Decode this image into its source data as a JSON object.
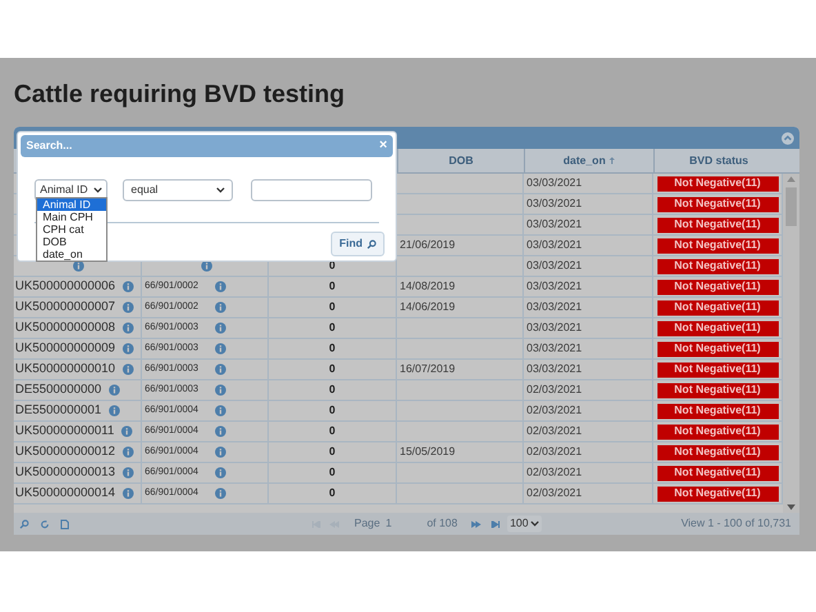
{
  "page_title": "Cattle requiring BVD testing",
  "grid": {
    "columns": [
      {
        "label": "DOB",
        "sorted": false
      },
      {
        "label": "date_on",
        "sorted": true
      },
      {
        "label": "BVD status",
        "sorted": false
      }
    ],
    "rows": [
      {
        "date_on": "03/03/2021",
        "status": "Not Negative(11)"
      },
      {
        "date_on": "03/03/2021",
        "status": "Not Negative(11)"
      },
      {
        "date_on": "03/03/2021",
        "status": "Not Negative(11)"
      },
      {
        "dob": "21/06/2019",
        "date_on": "03/03/2021",
        "status": "Not Negative(11)"
      },
      {
        "icons": true,
        "cph_cat": "0",
        "date_on": "03/03/2021",
        "status": "Not Negative(11)"
      },
      {
        "icons": true,
        "animal_id": "UK500000000006",
        "main_cph": "66/901/0002",
        "cph_cat": "0",
        "dob": "14/08/2019",
        "date_on": "03/03/2021",
        "status": "Not Negative(11)"
      },
      {
        "icons": true,
        "animal_id": "UK500000000007",
        "main_cph": "66/901/0002",
        "cph_cat": "0",
        "dob": "14/06/2019",
        "date_on": "03/03/2021",
        "status": "Not Negative(11)"
      },
      {
        "icons": true,
        "animal_id": "UK500000000008",
        "main_cph": "66/901/0003",
        "cph_cat": "0",
        "date_on": "03/03/2021",
        "status": "Not Negative(11)"
      },
      {
        "icons": true,
        "animal_id": "UK500000000009",
        "main_cph": "66/901/0003",
        "cph_cat": "0",
        "date_on": "03/03/2021",
        "status": "Not Negative(11)"
      },
      {
        "icons": true,
        "animal_id": "UK500000000010",
        "main_cph": "66/901/0003",
        "cph_cat": "0",
        "dob": "16/07/2019",
        "date_on": "03/03/2021",
        "status": "Not Negative(11)"
      },
      {
        "icons": true,
        "animal_id": "DE5500000000",
        "main_cph": "66/901/0003",
        "cph_cat": "0",
        "date_on": "02/03/2021",
        "status": "Not Negative(11)"
      },
      {
        "icons": true,
        "animal_id": "DE5500000001",
        "main_cph": "66/901/0004",
        "cph_cat": "0",
        "date_on": "02/03/2021",
        "status": "Not Negative(11)"
      },
      {
        "icons": true,
        "animal_id": "UK500000000011",
        "main_cph": "66/901/0004",
        "cph_cat": "0",
        "date_on": "02/03/2021",
        "status": "Not Negative(11)"
      },
      {
        "icons": true,
        "animal_id": "UK500000000012",
        "main_cph": "66/901/0004",
        "cph_cat": "0",
        "dob": "15/05/2019",
        "date_on": "02/03/2021",
        "status": "Not Negative(11)"
      },
      {
        "icons": true,
        "animal_id": "UK500000000013",
        "main_cph": "66/901/0004",
        "cph_cat": "0",
        "date_on": "02/03/2021",
        "status": "Not Negative(11)"
      },
      {
        "icons": true,
        "animal_id": "UK500000000014",
        "main_cph": "66/901/0004",
        "cph_cat": "0",
        "date_on": "02/03/2021",
        "status": "Not Negative(11)"
      }
    ],
    "pager": {
      "page_label": "Page",
      "page": "1",
      "of_pages": "of 108",
      "page_size": "100",
      "summary": "View 1 - 100 of 10,731"
    }
  },
  "search_dialog": {
    "title": "Search...",
    "close": "×",
    "field": "Animal ID",
    "field_options": [
      {
        "label": "Animal ID",
        "selected": true
      },
      {
        "label": "Main CPH",
        "selected": false
      },
      {
        "label": "CPH cat",
        "selected": false
      },
      {
        "label": "DOB",
        "selected": false
      },
      {
        "label": "date_on",
        "selected": false
      }
    ],
    "operator": "equal",
    "find_button": "Find"
  }
}
